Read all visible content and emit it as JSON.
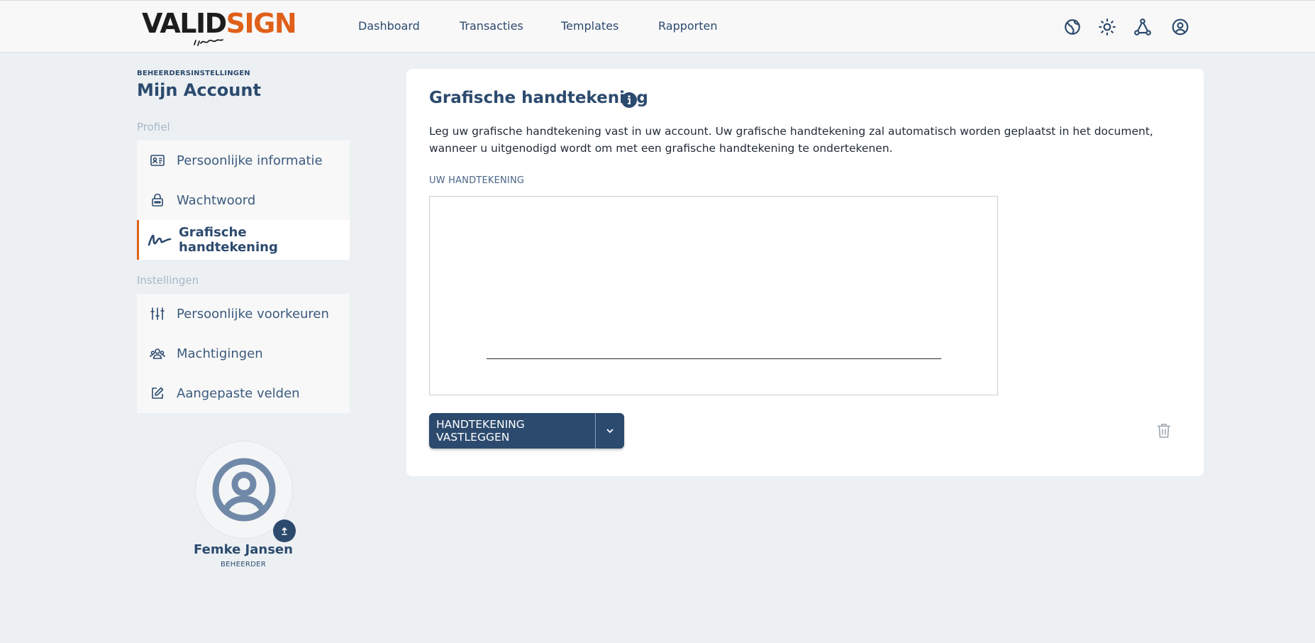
{
  "brand": {
    "part1": "VALID",
    "part2": "SIGN",
    "accent_color": "#e0601a",
    "primary_color": "#2c4a6e"
  },
  "nav": {
    "items": [
      {
        "label": "Dashboard"
      },
      {
        "label": "Transacties"
      },
      {
        "label": "Templates"
      },
      {
        "label": "Rapporten"
      }
    ],
    "icons": [
      "globe-icon",
      "sun-icon",
      "network-icon",
      "user-circle-icon"
    ]
  },
  "sidebar": {
    "breadcrumb": "BEHEERDERSINSTELLINGEN",
    "title": "Mijn Account",
    "sections": [
      {
        "label": "Profiel",
        "items": [
          {
            "label": "Persoonlijke informatie",
            "icon": "id-card-icon",
            "active": false
          },
          {
            "label": "Wachtwoord",
            "icon": "lock-icon",
            "active": false
          },
          {
            "label": "Grafische handtekening",
            "icon": "signature-icon",
            "active": true
          }
        ]
      },
      {
        "label": "Instellingen",
        "items": [
          {
            "label": "Persoonlijke voorkeuren",
            "icon": "sliders-icon",
            "active": false
          },
          {
            "label": "Machtigingen",
            "icon": "users-icon",
            "active": false
          },
          {
            "label": "Aangepaste velden",
            "icon": "edit-icon",
            "active": false
          }
        ]
      }
    ]
  },
  "user": {
    "name": "Femke Jansen",
    "role": "BEHEERDER"
  },
  "main": {
    "title": "Grafische handtekening",
    "description": "Leg uw grafische handtekening vast in uw account. Uw grafische handtekening zal automatisch worden geplaatst in het document, wanneer u uitgenodigd wordt om met een grafische handtekening te ondertekenen.",
    "signature_label": "UW HANDTEKENING",
    "capture_button": "HANDTEKENING VASTLEGGEN"
  }
}
